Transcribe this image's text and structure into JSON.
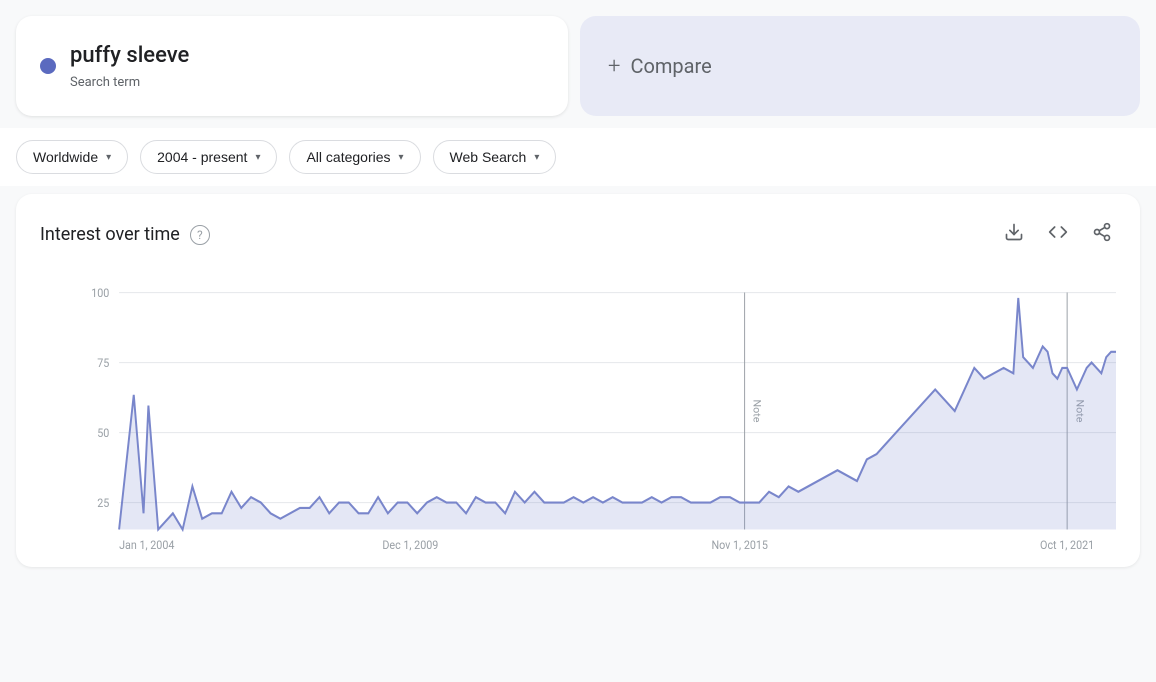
{
  "search_term": {
    "label": "puffy sleeve",
    "sublabel": "Search term",
    "dot_color": "#5b6abf"
  },
  "compare": {
    "plus": "+",
    "label": "Compare"
  },
  "filters": {
    "location": {
      "label": "Worldwide",
      "value": "Worldwide"
    },
    "time_range": {
      "label": "2004 - present",
      "value": "2004 - present"
    },
    "category": {
      "label": "All categories",
      "value": "All categories"
    },
    "search_type": {
      "label": "Web Search",
      "value": "Web Search"
    }
  },
  "chart": {
    "title": "Interest over time",
    "help_label": "?",
    "x_labels": [
      "Jan 1, 2004",
      "Dec 1, 2009",
      "Nov 1, 2015",
      "Oct 1, 2021"
    ],
    "y_labels": [
      "100",
      "75",
      "50",
      "25"
    ],
    "note_labels": [
      "Note",
      "Note"
    ],
    "download_icon": "⬇",
    "embed_icon": "<>",
    "share_icon": "↗"
  }
}
